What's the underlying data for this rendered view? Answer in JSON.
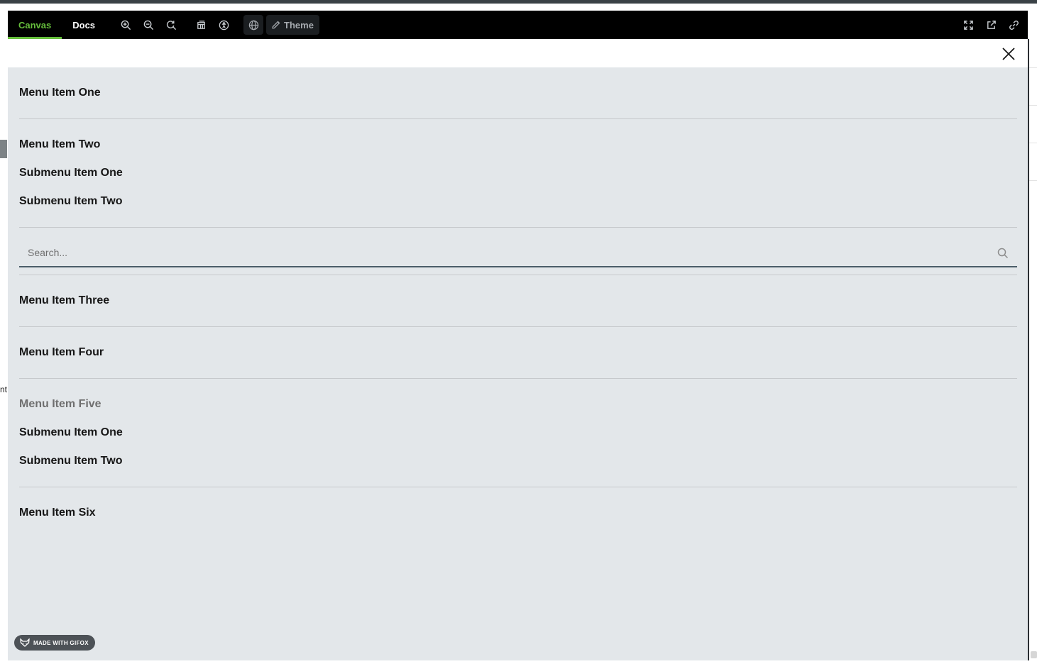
{
  "toolbar": {
    "tabs": [
      {
        "label": "Canvas",
        "active": true
      },
      {
        "label": "Docs",
        "active": false
      }
    ],
    "theme_label": "Theme",
    "accent_color": "#66bf3c"
  },
  "background": {
    "left_text": "nt"
  },
  "menu": {
    "item_one": "Menu Item One",
    "item_two": "Menu Item Two",
    "item_two_sub_one": "Submenu Item One",
    "item_two_sub_two": "Submenu Item Two",
    "search_placeholder": "Search...",
    "item_three": "Menu Item Three",
    "item_four": "Menu Item Four",
    "item_five": "Menu Item Five",
    "item_five_sub_one": "Submenu Item One",
    "item_five_sub_two": "Submenu Item Two",
    "item_six": "Menu Item Six"
  },
  "badge": {
    "label": "MADE WITH GIFOX"
  }
}
